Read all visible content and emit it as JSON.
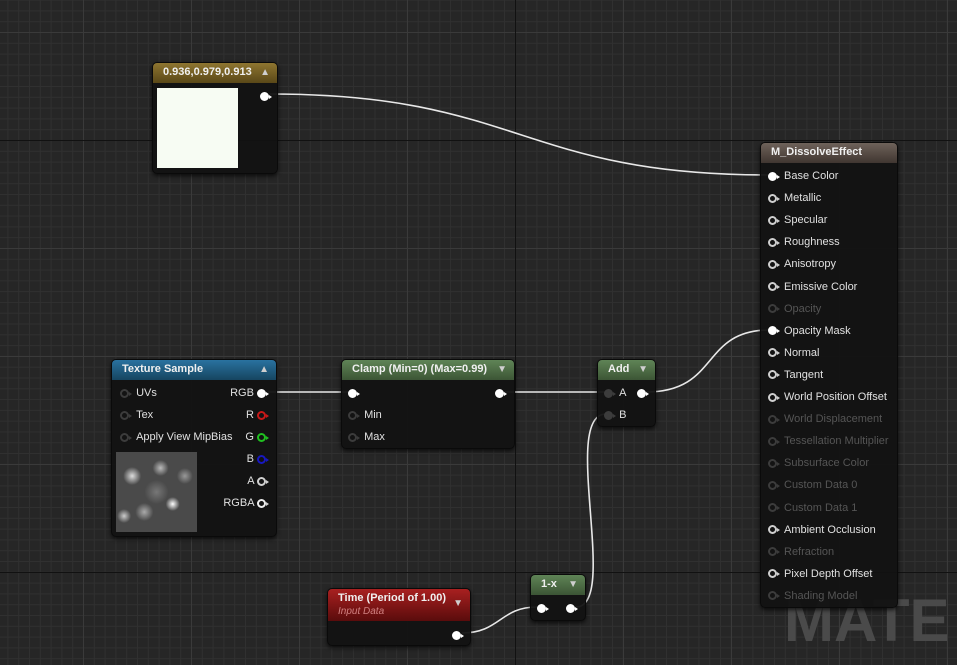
{
  "watermark": "MATE",
  "constant_node": {
    "title": "0.936,0.979,0.913",
    "swatch_color": "#f7fcf3",
    "header_color": "#7a6322"
  },
  "texture_node": {
    "title": "Texture Sample",
    "header_color": "#1f5b82",
    "inputs": [
      "UVs",
      "Tex",
      "Apply View MipBias"
    ],
    "outputs": [
      "RGB",
      "R",
      "G",
      "B",
      "A",
      "RGBA"
    ]
  },
  "clamp_node": {
    "title": "Clamp (Min=0) (Max=0.99)",
    "inputs": [
      "Min",
      "Max"
    ],
    "header_color": "#4f6e46"
  },
  "add_node": {
    "title": "Add",
    "inputs": [
      "A",
      "B"
    ]
  },
  "time_node": {
    "title": "Time (Period of 1.00)",
    "subtitle": "Input Data",
    "header_color": "#8a1a1a"
  },
  "oneminus_node": {
    "title": "1-x"
  },
  "result_node": {
    "title": "M_DissolveEffect",
    "header_color": "#5b4f47",
    "pins": [
      {
        "label": "Base Color",
        "state": "connected"
      },
      {
        "label": "Metallic",
        "state": "enabled"
      },
      {
        "label": "Specular",
        "state": "enabled"
      },
      {
        "label": "Roughness",
        "state": "enabled"
      },
      {
        "label": "Anisotropy",
        "state": "enabled"
      },
      {
        "label": "Emissive Color",
        "state": "enabled"
      },
      {
        "label": "Opacity",
        "state": "disabled"
      },
      {
        "label": "Opacity Mask",
        "state": "connected"
      },
      {
        "label": "Normal",
        "state": "enabled"
      },
      {
        "label": "Tangent",
        "state": "enabled"
      },
      {
        "label": "World Position Offset",
        "state": "enabled"
      },
      {
        "label": "World Displacement",
        "state": "disabled"
      },
      {
        "label": "Tessellation Multiplier",
        "state": "disabled"
      },
      {
        "label": "Subsurface Color",
        "state": "disabled"
      },
      {
        "label": "Custom Data 0",
        "state": "disabled"
      },
      {
        "label": "Custom Data 1",
        "state": "disabled"
      },
      {
        "label": "Ambient Occlusion",
        "state": "enabled"
      },
      {
        "label": "Refraction",
        "state": "disabled"
      },
      {
        "label": "Pixel Depth Offset",
        "state": "enabled"
      },
      {
        "label": "Shading Model",
        "state": "disabled"
      }
    ]
  }
}
